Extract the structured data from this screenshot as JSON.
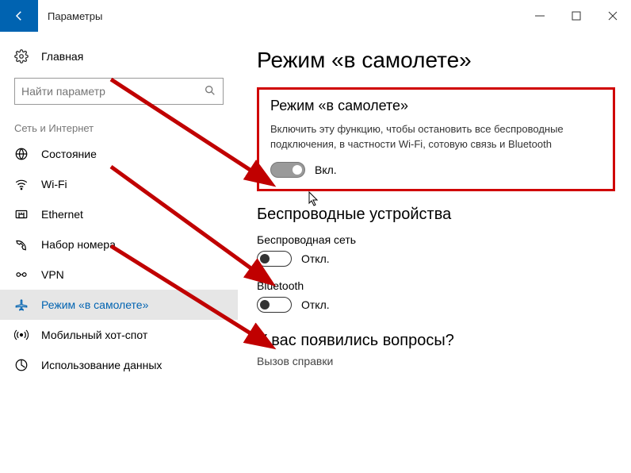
{
  "titlebar": {
    "title": "Параметры"
  },
  "sidebar": {
    "home": "Главная",
    "search_placeholder": "Найти параметр",
    "section": "Сеть и Интернет",
    "items": [
      {
        "label": "Состояние",
        "icon": "globe"
      },
      {
        "label": "Wi-Fi",
        "icon": "wifi"
      },
      {
        "label": "Ethernet",
        "icon": "ethernet"
      },
      {
        "label": "Набор номера",
        "icon": "dialup"
      },
      {
        "label": "VPN",
        "icon": "vpn"
      },
      {
        "label": "Режим «в самолете»",
        "icon": "airplane",
        "active": true
      },
      {
        "label": "Мобильный хот-спот",
        "icon": "hotspot"
      },
      {
        "label": "Использование данных",
        "icon": "data"
      }
    ]
  },
  "main": {
    "title": "Режим «в самолете»",
    "airplane": {
      "heading": "Режим «в самолете»",
      "description": "Включить эту функцию, чтобы остановить все беспроводные подключения, в частности Wi-Fi, сотовую связь и Bluetooth",
      "state": "Вкл.",
      "on": true
    },
    "wireless": {
      "heading": "Беспроводные устройства",
      "devices": [
        {
          "label": "Беспроводная сеть",
          "state": "Откл.",
          "on": false
        },
        {
          "label": "Bluetooth",
          "state": "Откл.",
          "on": false
        }
      ]
    },
    "questions": {
      "heading": "У вас появились вопросы?",
      "link": "Вызов справки"
    }
  }
}
